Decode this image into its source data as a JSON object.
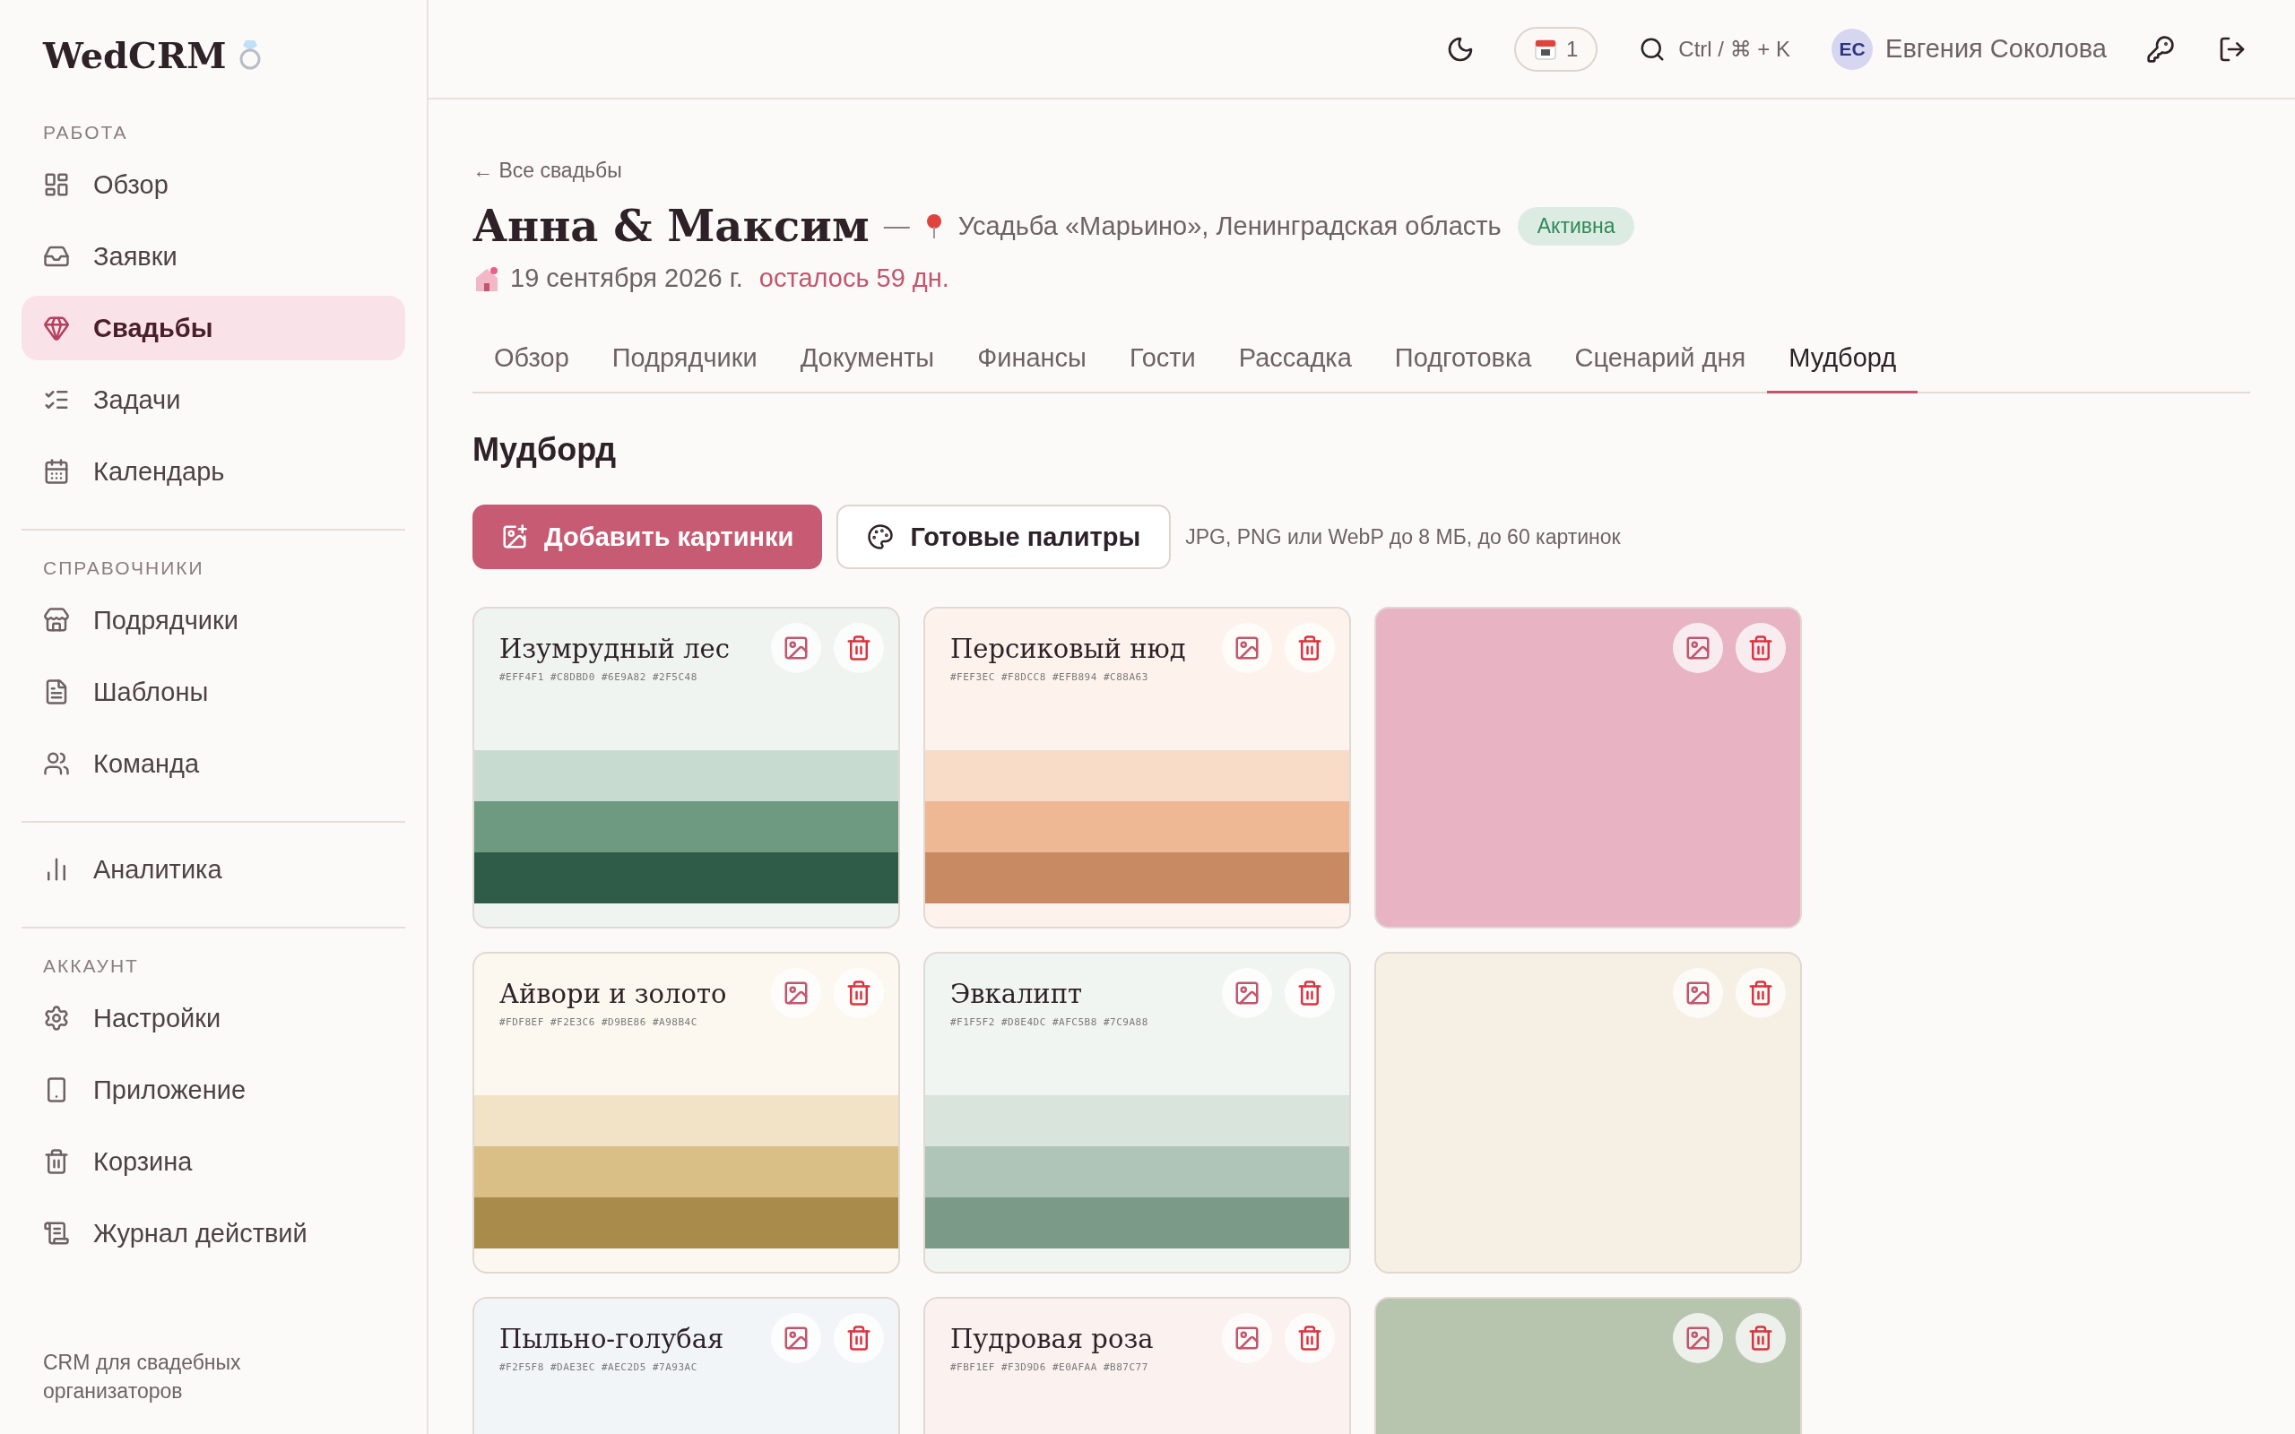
{
  "sidebar": {
    "logo": "WedCRM",
    "sections": [
      {
        "label": "РАБОТА",
        "items": [
          {
            "label": "Обзор",
            "selected": false
          },
          {
            "label": "Заявки",
            "selected": false
          },
          {
            "label": "Свадьбы",
            "selected": true
          },
          {
            "label": "Задачи",
            "selected": false
          },
          {
            "label": "Календарь",
            "selected": false
          }
        ]
      },
      {
        "label": "СПРАВОЧНИКИ",
        "items": [
          {
            "label": "Подрядчики",
            "selected": false
          },
          {
            "label": "Шаблоны",
            "selected": false
          },
          {
            "label": "Команда",
            "selected": false
          }
        ]
      },
      {
        "items": [
          {
            "label": "Аналитика",
            "selected": false
          }
        ]
      },
      {
        "label": "АККАУНТ",
        "items": [
          {
            "label": "Настройки",
            "selected": false
          },
          {
            "label": "Приложение",
            "selected": false
          },
          {
            "label": "Корзина",
            "selected": false
          },
          {
            "label": "Журнал действий",
            "selected": false
          }
        ]
      }
    ],
    "footer": "CRM для свадебных организаторов"
  },
  "topbar": {
    "calendar_count": "1",
    "search_hint": "Ctrl / ⌘ + K",
    "user_initials": "ЕС",
    "user_name": "Евгения Соколова"
  },
  "wedding": {
    "back_link": "← Все свадьбы",
    "title": "Анна & Максим",
    "separator": "—",
    "venue": "Усадьба «Марьино», Ленинградская область",
    "status": "Активна",
    "date": "19 сентября 2026 г.",
    "countdown": "осталось 59 дн."
  },
  "tabs": [
    {
      "label": "Обзор",
      "selected": false
    },
    {
      "label": "Подрядчики",
      "selected": false
    },
    {
      "label": "Документы",
      "selected": false
    },
    {
      "label": "Финансы",
      "selected": false
    },
    {
      "label": "Гости",
      "selected": false
    },
    {
      "label": "Рассадка",
      "selected": false
    },
    {
      "label": "Подготовка",
      "selected": false
    },
    {
      "label": "Сценарий дня",
      "selected": false
    },
    {
      "label": "Мудборд",
      "selected": true
    }
  ],
  "moodboard": {
    "heading": "Мудборд",
    "add_button": "Добавить картинки",
    "palettes_button": "Готовые палитры",
    "hint": "JPG, PNG или WebP до 8 МБ, до 60 картинок",
    "cards": [
      {
        "kind": "palette",
        "title": "Изумрудный лес",
        "hex_codes": [
          "#EFF4F1",
          "#C8DBD0",
          "#6E9A82",
          "#2F5C48"
        ]
      },
      {
        "kind": "palette",
        "title": "Персиковый нюд",
        "hex_codes": [
          "#FEF3EC",
          "#F8DCC8",
          "#EFB894",
          "#C88A63"
        ]
      },
      {
        "kind": "image",
        "color": "#e8b4c4"
      },
      {
        "kind": "palette",
        "title": "Айвори и золото",
        "hex_codes": [
          "#FDF8EF",
          "#F2E3C6",
          "#D9BE86",
          "#A98B4C"
        ]
      },
      {
        "kind": "palette",
        "title": "Эвкалипт",
        "hex_codes": [
          "#F1F5F2",
          "#D8E4DC",
          "#AFC5B8",
          "#7C9A88"
        ]
      },
      {
        "kind": "image",
        "color": "#f6efe4"
      },
      {
        "kind": "palette",
        "title": "Пыльно-голубая",
        "hex_codes": [
          "#F2F5F8",
          "#DAE3EC",
          "#AEC2D5",
          "#7A93AC"
        ]
      },
      {
        "kind": "palette",
        "title": "Пудровая роза",
        "hex_codes": [
          "#FBF1EF",
          "#F3D9D6",
          "#E0AFAA",
          "#B87C77"
        ]
      },
      {
        "kind": "image",
        "color": "#b7c4ae"
      }
    ]
  }
}
